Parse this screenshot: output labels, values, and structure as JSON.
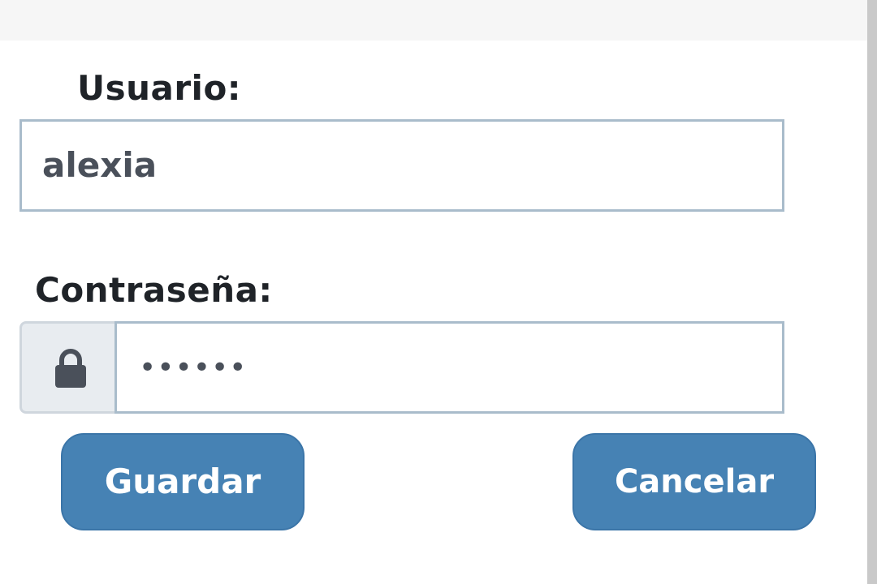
{
  "form": {
    "username_label": "Usuario:",
    "username_value": "alexia",
    "password_label": "Contraseña:",
    "password_masked": "••••••",
    "lock_icon": "lock-icon"
  },
  "actions": {
    "save_label": "Guardar",
    "cancel_label": "Cancelar"
  },
  "colors": {
    "button_bg": "#4682b4",
    "field_border": "#a9bccb",
    "addon_bg": "#e8ecf0",
    "text": "#1f2328"
  }
}
